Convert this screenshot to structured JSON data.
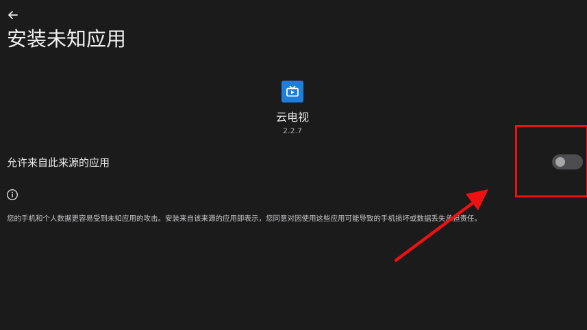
{
  "header": {
    "back_icon": "arrow-left-icon",
    "title": "安装未知应用"
  },
  "app": {
    "icon": "tv-icon",
    "icon_color": "#1e7ed9",
    "name": "云电视",
    "version": "2.2.7"
  },
  "setting": {
    "label": "允许来自此来源的应用",
    "toggle_state": "off"
  },
  "info": {
    "icon": "info-icon",
    "text": "您的手机和个人数据更容易受到未知应用的攻击。安装来自该来源的应用即表示，您同意对因使用这些应用可能导致的手机损坏或数据丢失承担责任。"
  },
  "annotation": {
    "color": "#ee1111",
    "highlight_target": "toggle",
    "arrow_points_to": "toggle"
  }
}
